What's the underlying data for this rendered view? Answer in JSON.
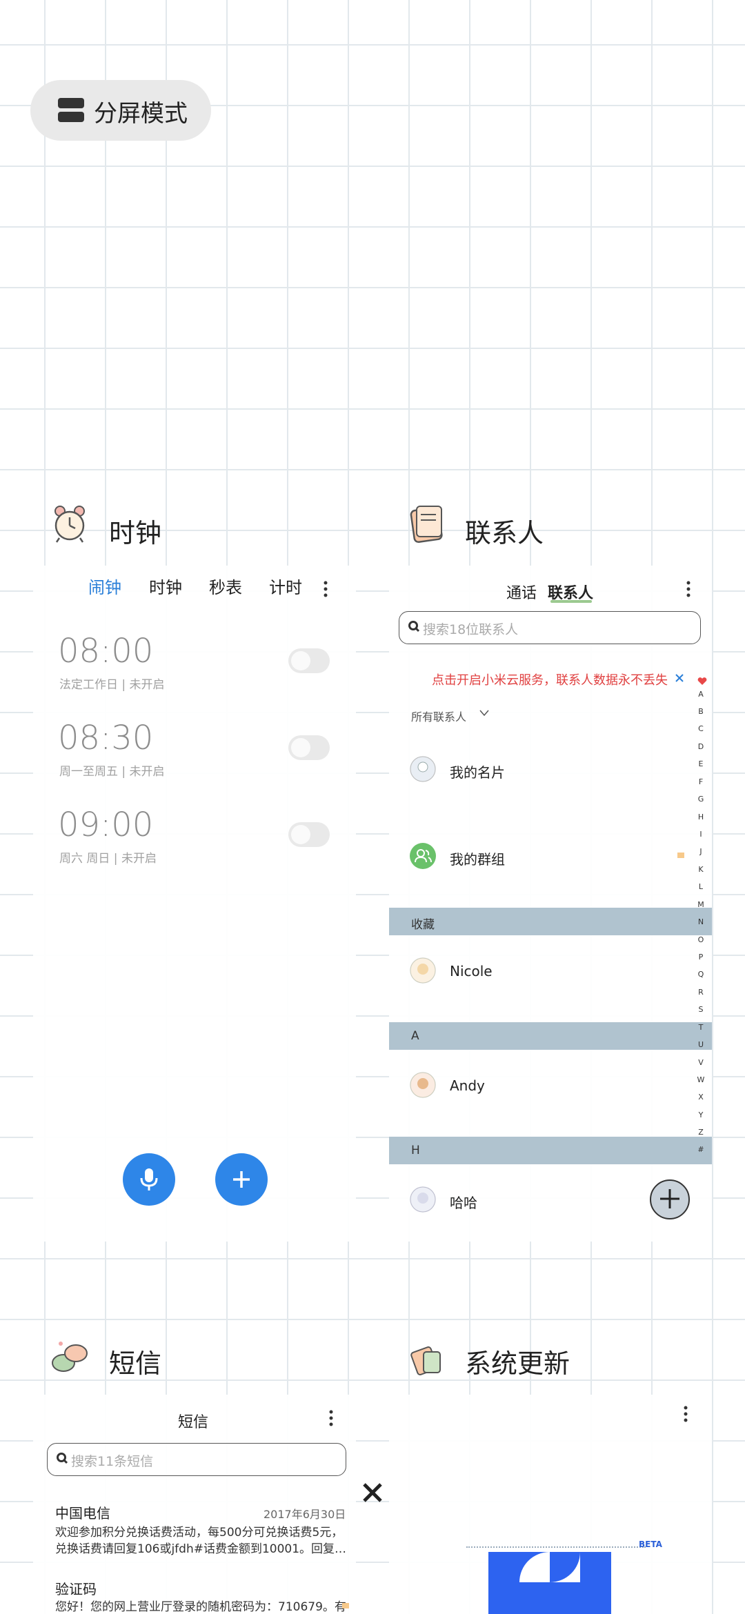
{
  "split_screen": {
    "label": "分屏模式",
    "icon": "split-screen-icon"
  },
  "clock_app": {
    "title": "时钟",
    "tabs": [
      "闹钟",
      "时钟",
      "秒表",
      "计时"
    ],
    "active_tab": "闹钟",
    "alarms": [
      {
        "time": "08:00",
        "repeat": "法定工作日 | 未开启",
        "enabled": false
      },
      {
        "time": "08:30",
        "repeat": "周一至周五 | 未开启",
        "enabled": false
      },
      {
        "time": "09:00",
        "repeat": "周六 周日 | 未开启",
        "enabled": false
      }
    ]
  },
  "contacts_app": {
    "title": "联系人",
    "tabs": [
      "通话",
      "联系人"
    ],
    "active_tab": "联系人",
    "search_placeholder": "搜索18位联系人",
    "cloud_notice": "点击开启小米云服务，联系人数据永不丢失",
    "filter_label": "所有联系人",
    "my_card": "我的名片",
    "my_groups": "我的群组",
    "sections": [
      {
        "header": "收藏",
        "contact": "Nicole"
      },
      {
        "header": "A",
        "contact": "Andy"
      },
      {
        "header": "H",
        "contact": "哈哈"
      }
    ],
    "index": [
      "A",
      "B",
      "C",
      "D",
      "E",
      "F",
      "G",
      "H",
      "I",
      "J",
      "K",
      "L",
      "M",
      "N",
      "O",
      "P",
      "Q",
      "R",
      "S",
      "T",
      "U",
      "V",
      "W",
      "X",
      "Y",
      "Z",
      "#"
    ],
    "colors": {
      "notice": "#e04040",
      "section_bar": "#b0c3cf",
      "favorite_heart": "#e84848"
    }
  },
  "sms_app": {
    "title": "短信",
    "header_title": "短信",
    "search_placeholder": "搜索11条短信",
    "messages": [
      {
        "sender": "中国电信",
        "date": "2017年6月30日",
        "body": "欢迎参加积分兑换话费活动，每500分可兑换话费5元，兑换话费请回复106或jfdh#话费金额到10001。回复…"
      },
      {
        "sender": "验证码",
        "date": "",
        "body": "您好！您的网上营业厅登录的随机密码为：710679。有"
      }
    ]
  },
  "update_app": {
    "title": "系统更新",
    "badge": "BETA"
  },
  "colors": {
    "accent": "#2a7fd8",
    "fab": "#2e86e8"
  }
}
